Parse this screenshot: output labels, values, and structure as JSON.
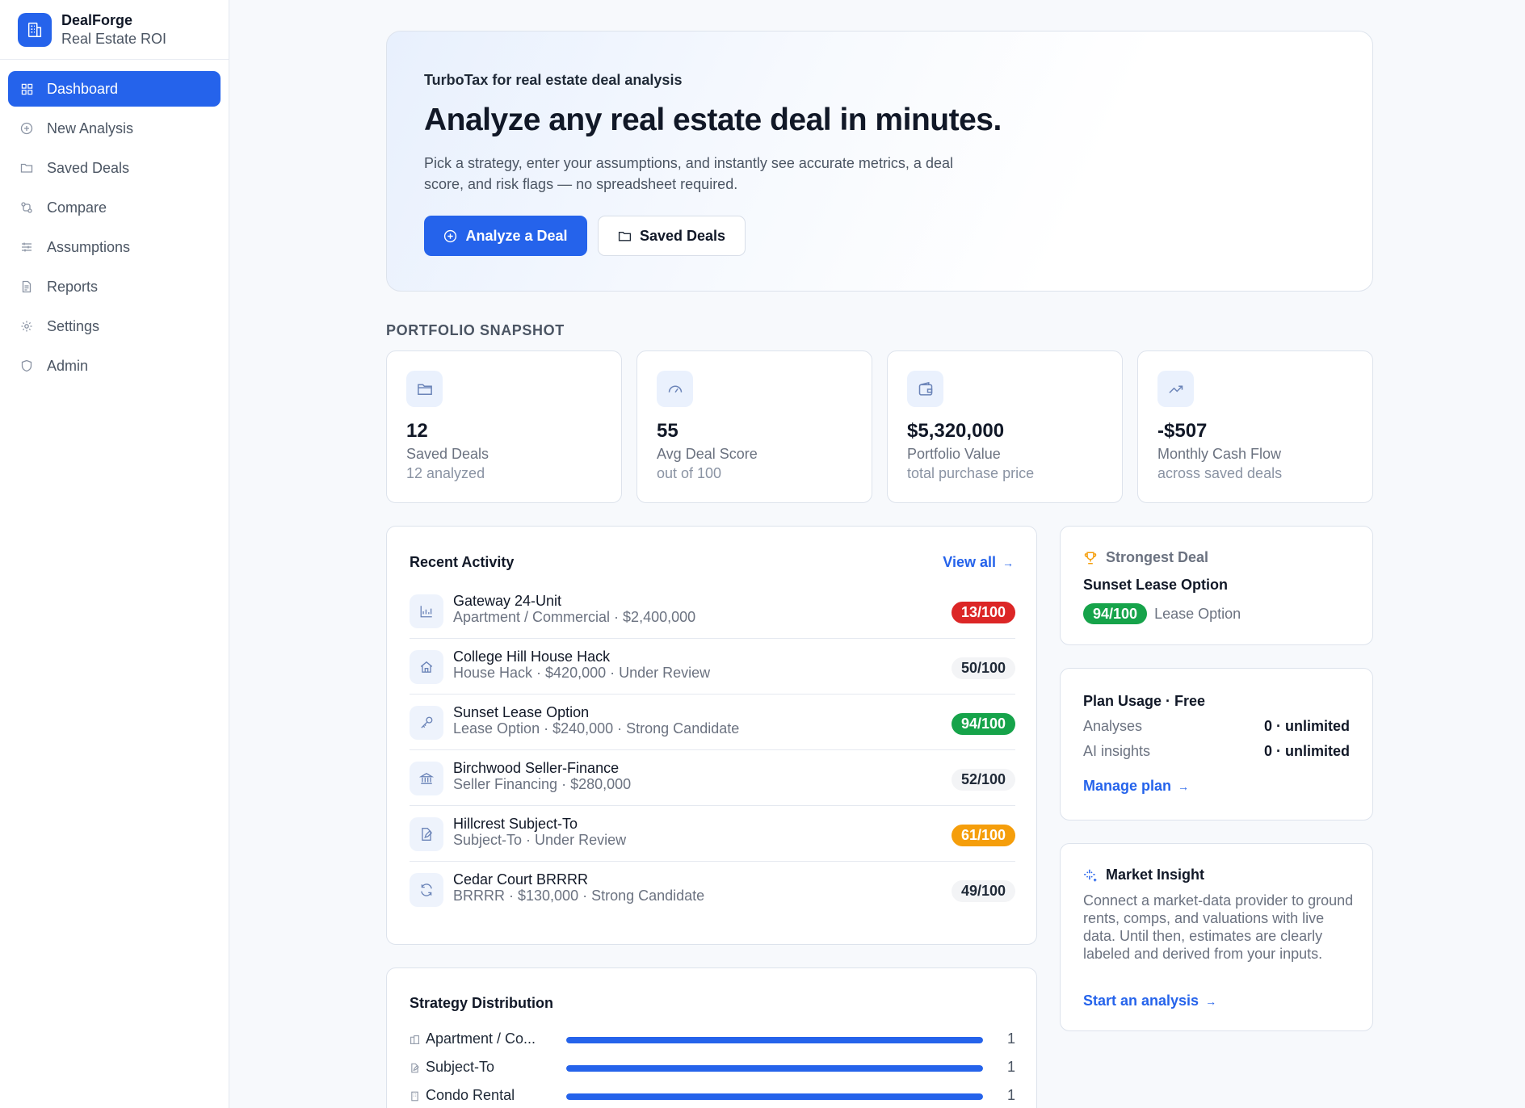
{
  "brand": {
    "name": "DealForge",
    "subtitle": "Real Estate ROI"
  },
  "sidebar": {
    "items": [
      {
        "label": "Dashboard",
        "icon": "grid-icon",
        "active": true
      },
      {
        "label": "New Analysis",
        "icon": "plus-circle-icon"
      },
      {
        "label": "Saved Deals",
        "icon": "folder-icon"
      },
      {
        "label": "Compare",
        "icon": "compare-icon"
      },
      {
        "label": "Assumptions",
        "icon": "sliders-icon"
      },
      {
        "label": "Reports",
        "icon": "document-icon"
      },
      {
        "label": "Settings",
        "icon": "gear-icon"
      },
      {
        "label": "Admin",
        "icon": "shield-icon"
      }
    ]
  },
  "hero": {
    "tagline": "TurboTax for real estate deal analysis",
    "title": "Analyze any real estate deal in minutes.",
    "description": "Pick a strategy, enter your assumptions, and instantly see accurate metrics, a deal score, and risk flags — no spreadsheet required.",
    "primary_button": "Analyze a Deal",
    "secondary_button": "Saved Deals"
  },
  "snapshot": {
    "label": "PORTFOLIO SNAPSHOT",
    "cards": [
      {
        "value": "12",
        "label": "Saved Deals",
        "sub": "12 analyzed",
        "icon": "folder-icon"
      },
      {
        "value": "55",
        "label": "Avg Deal Score",
        "sub": "out of 100",
        "icon": "gauge-icon"
      },
      {
        "value": "$5,320,000",
        "label": "Portfolio Value",
        "sub": "total purchase price",
        "icon": "wallet-icon"
      },
      {
        "value": "-$507",
        "label": "Monthly Cash Flow",
        "sub": "across saved deals",
        "icon": "trending-up-icon"
      }
    ]
  },
  "activity": {
    "title": "Recent Activity",
    "view_all": "View all",
    "items": [
      {
        "title": "Gateway 24-Unit",
        "sub": "Apartment / Commercial · $2,400,000",
        "score": "13/100",
        "tone": "red",
        "icon": "chart-icon"
      },
      {
        "title": "College Hill House Hack",
        "sub": "House Hack · $420,000 · Under Review",
        "score": "50/100",
        "tone": "neutral",
        "icon": "home-icon"
      },
      {
        "title": "Sunset Lease Option",
        "sub": "Lease Option · $240,000 · Strong Candidate",
        "score": "94/100",
        "tone": "green",
        "icon": "key-icon"
      },
      {
        "title": "Birchwood Seller-Finance",
        "sub": "Seller Financing · $280,000",
        "score": "52/100",
        "tone": "neutral",
        "icon": "bank-icon"
      },
      {
        "title": "Hillcrest Subject-To",
        "sub": "Subject-To · Under Review",
        "score": "61/100",
        "tone": "amber",
        "icon": "edit-doc-icon"
      },
      {
        "title": "Cedar Court BRRRR",
        "sub": "BRRRR · $130,000 · Strong Candidate",
        "score": "49/100",
        "tone": "neutral",
        "icon": "refresh-icon"
      }
    ]
  },
  "distribution": {
    "title": "Strategy Distribution",
    "items": [
      {
        "label": "Apartment / Co...",
        "count": "1",
        "fraction": 1.0,
        "icon": "building-icon"
      },
      {
        "label": "Subject-To",
        "count": "1",
        "fraction": 1.0,
        "icon": "edit-doc-icon"
      },
      {
        "label": "Condo Rental",
        "count": "1",
        "fraction": 1.0,
        "icon": "condo-icon"
      }
    ]
  },
  "strongest": {
    "title": "Strongest Deal",
    "deal": "Sunset Lease Option",
    "score": "94/100",
    "strategy": "Lease Option"
  },
  "plan": {
    "title": "Plan Usage · Free",
    "rows": [
      {
        "key": "Analyses",
        "value": "0 · unlimited"
      },
      {
        "key": "AI insights",
        "value": "0 · unlimited"
      }
    ],
    "link": "Manage plan"
  },
  "insight": {
    "title": "Market Insight",
    "body": "Connect a market-data provider to ground rents, comps, and valuations with live data. Until then, estimates are clearly labeled and derived from your inputs.",
    "link": "Start an analysis"
  },
  "colors": {
    "accent": "#2563eb",
    "danger": "#dc2626",
    "success": "#16a34a",
    "warning": "#f59e0b"
  }
}
